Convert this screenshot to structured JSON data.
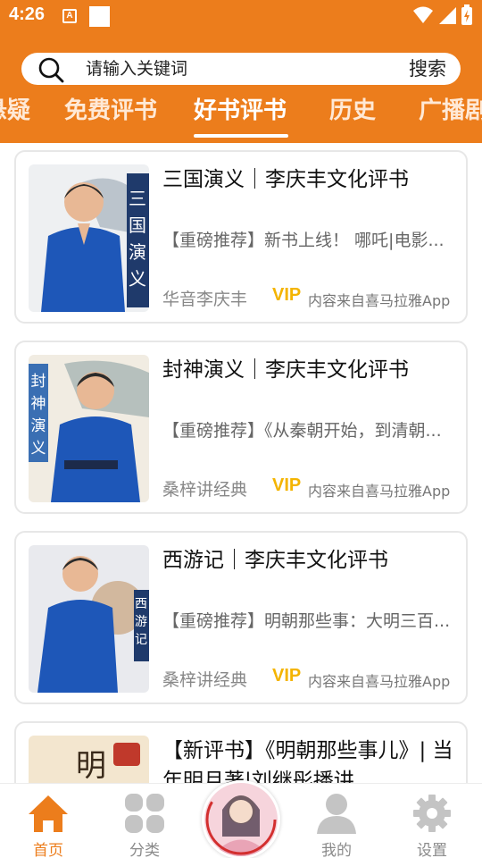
{
  "status_bar": {
    "time": "4:26",
    "notif_glyph": "A"
  },
  "search": {
    "placeholder": "请输入关键词",
    "button_label": "搜索"
  },
  "tabs": [
    {
      "label": "悬疑",
      "active": false
    },
    {
      "label": "免费评书",
      "active": false
    },
    {
      "label": "好书评书",
      "active": true
    },
    {
      "label": "历史",
      "active": false
    },
    {
      "label": "广播剧",
      "active": false
    }
  ],
  "cards": [
    {
      "title": "三国演义｜李庆丰文化评书",
      "desc": "【重磅推荐】新书上线！ 哪吒|电影...",
      "author": "华音李庆丰",
      "vip": "VIP",
      "source": "内容来自喜马拉雅App",
      "cover_text": "三国演义"
    },
    {
      "title": "封神演义｜李庆丰文化评书",
      "desc": "【重磅推荐】《从秦朝开始，到清朝...",
      "author": "桑梓讲经典",
      "vip": "VIP",
      "source": "内容来自喜马拉雅App",
      "cover_text": "封神演义"
    },
    {
      "title": "西游记｜李庆丰文化评书",
      "desc": "【重磅推荐】明朝那些事：大明三百...",
      "author": "桑梓讲经典",
      "vip": "VIP",
      "source": "内容来自喜马拉雅App",
      "cover_text": "西游记"
    },
    {
      "title": "【新评书】《明朝那些事儿》| 当年明月著|刘继彤播讲",
      "cover_text": "明朝"
    }
  ],
  "bottom_nav": [
    {
      "label": "首页",
      "icon": "home-icon",
      "active": true
    },
    {
      "label": "分类",
      "icon": "grid-icon",
      "active": false
    },
    {
      "label": "我的",
      "icon": "user-icon",
      "active": false
    },
    {
      "label": "设置",
      "icon": "gear-icon",
      "active": false
    }
  ],
  "colors": {
    "accent": "#ec7d1c",
    "vip": "#f4b400",
    "cover_blue": "#1e57b8"
  }
}
